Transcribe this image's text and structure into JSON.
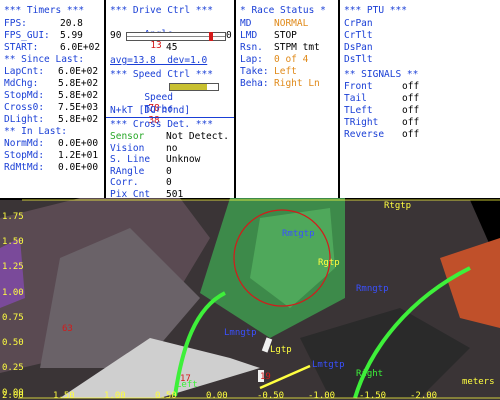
{
  "timers": {
    "title": "*** Timers ***",
    "rows": [
      {
        "label": "FPS:",
        "value": "20.8"
      },
      {
        "label": "FPS_GUI:",
        "value": "5.99"
      },
      {
        "label": "START:",
        "value": "6.0E+02"
      }
    ],
    "since_title": "** Since Last:",
    "since": [
      {
        "label": "LapCnt:",
        "value": "6.0E+02"
      },
      {
        "label": "MdChg:",
        "value": "5.8E+02"
      },
      {
        "label": "StopMd:",
        "value": "5.8E+02"
      },
      {
        "label": "Cross0:",
        "value": "7.5E+03"
      },
      {
        "label": "DLight:",
        "value": "5.8E+02"
      }
    ],
    "in_title": "** In Last:",
    "in_last": [
      {
        "label": "NormMd:",
        "value": "0.0E+00"
      },
      {
        "label": "StopMd:",
        "value": "1.2E+01"
      },
      {
        "label": "RdMtMd:",
        "value": "0.0E+00"
      }
    ]
  },
  "drive": {
    "title": "*** Drive Ctrl ***",
    "angle_label": "Angle",
    "angle_value": "13",
    "slider_min": "90",
    "slider_max": "0",
    "slider_mid": "45",
    "slider_level": 0.87,
    "avg_line": "avg=13.8  dev=1.0",
    "speed_title": "*** Speed Ctrl ***",
    "speed_label": "Speed",
    "speed_value": "78",
    "speed_level": 0.78,
    "turbo_label": "Turbo",
    "turbo_value": "38",
    "mode_line": "N+kT [DC nfnd]"
  },
  "cross": {
    "title": "*** Cross Det. ***",
    "rows": [
      {
        "label": "Sensor",
        "value": "Not Detect."
      },
      {
        "label": "Vision",
        "value": "no"
      },
      {
        "label": "S. Line",
        "value": "Unknow"
      },
      {
        "label": "RAngle",
        "value": "0"
      },
      {
        "label": "Corr.",
        "value": "0"
      },
      {
        "label": "Pix Cnt",
        "value": "501"
      }
    ]
  },
  "race": {
    "title": "* Race Status *",
    "rows": [
      {
        "label": "MD",
        "value": "NORMAL"
      },
      {
        "label": "LMD",
        "value": "STOP"
      },
      {
        "label": "Rsn.",
        "value": "STPM tmt"
      },
      {
        "label": "Lap:",
        "value": "0 of 4"
      },
      {
        "label": "Take:",
        "value": "Left"
      },
      {
        "label": "Beha:",
        "value": "Right Ln"
      }
    ]
  },
  "ptu": {
    "title": "*** PTU ***",
    "items": [
      "CrPan",
      "CrTlt",
      "DsPan",
      "DsTlt"
    ],
    "signals_title": "** SIGNALS **",
    "signals": [
      {
        "label": "Front",
        "value": "off"
      },
      {
        "label": "Tail",
        "value": "off"
      },
      {
        "label": "TLeft",
        "value": "off"
      },
      {
        "label": "TRight",
        "value": "off"
      },
      {
        "label": "Reverse",
        "value": "off"
      }
    ]
  },
  "view": {
    "y_ticks": [
      "1.75",
      "1.50",
      "1.25",
      "1.00",
      "0.75",
      "0.50",
      "0.25",
      "0.00"
    ],
    "x_ticks": [
      "2.00",
      "1.50",
      "1.00",
      "0.50",
      "0.00",
      "-0.50",
      "-1.00",
      "-1.50",
      "-2.00"
    ],
    "unit": "meters",
    "labels": {
      "rtgtp": "Rtgtp",
      "rmtgtp": "Rmtgtp",
      "rgtp": "Rgtp",
      "rmngtp": "Rmngtp",
      "lmngtp": "Lmngtp",
      "lgtp": "Lgtp",
      "lmtgtp": "Lmtgtp",
      "right": "Right",
      "left": "Left",
      "n63": "63",
      "n19": "19",
      "n17": "17"
    }
  }
}
